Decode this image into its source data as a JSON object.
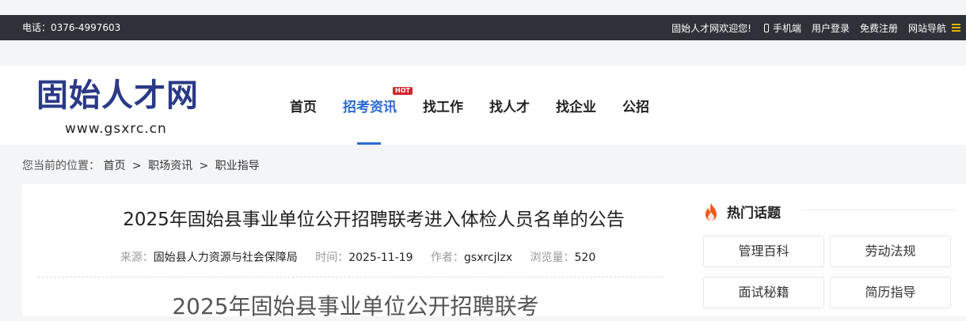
{
  "topbar": {
    "phone": "电话：0376-4997603",
    "welcome": "固始人才网欢迎您!",
    "mobile_label": "手机端",
    "login_label": "用户登录",
    "register_label": "免费注册",
    "sitenav_label": "网站导航"
  },
  "logo": {
    "title": "固始人才网",
    "url": "www.gsxrc.cn"
  },
  "nav": {
    "items": [
      "首页",
      "招考资讯",
      "找工作",
      "找人才",
      "找企业",
      "公招"
    ],
    "active_index": 1,
    "hot_badge": "HOT"
  },
  "breadcrumb": {
    "prefix": "您当前的位置：",
    "items": [
      "首页",
      "职场资讯",
      "职业指导"
    ],
    "separator": ">"
  },
  "article": {
    "title": "2025年固始县事业单位公开招聘联考进入体检人员名单的公告",
    "source_label": "来源：",
    "source": "固始县人力资源与社会保障局",
    "time_label": "时间：",
    "time": "2025-11-19",
    "author_label": "作者：",
    "author": "gsxrcjlzx",
    "views_label": "浏览量：",
    "views": "520",
    "body_heading": "2025年固始县事业单位公开招聘联考"
  },
  "sidebar": {
    "title": "热门话题",
    "topics": [
      "管理百科",
      "劳动法规",
      "面试秘籍",
      "简历指导"
    ]
  },
  "colors": {
    "topbar_bg": "#2e3138",
    "accent": "#2a6ad0",
    "hot_badge": "#d6252e",
    "logo": "#2b3a86",
    "fire": "#f05a1a"
  }
}
